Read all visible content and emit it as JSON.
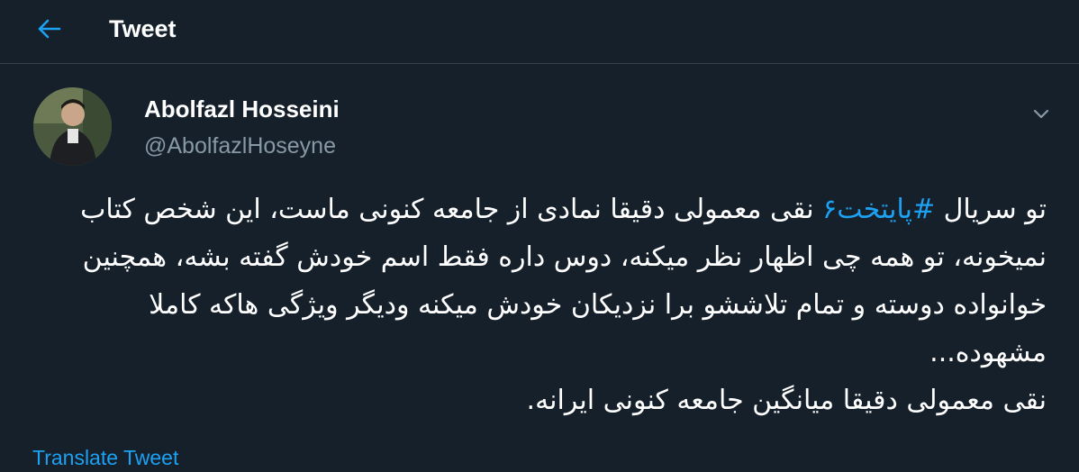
{
  "header": {
    "back_icon": "arrow-left-icon",
    "title": "Tweet"
  },
  "author": {
    "avatar_icon": "avatar",
    "name": "Abolfazl Hosseini",
    "handle": "@AbolfazlHoseyne",
    "menu_icon": "chevron-down-icon"
  },
  "tweet": {
    "text_before_hashtag": "تو سریال ",
    "hashtag": "#پایتخت۶",
    "text_after_hashtag": " نقی معمولی دقیقا نمادی از جامعه کنونی ماست، این شخص کتاب نمیخونه، تو همه چی اظهار نظر میکنه، دوس داره فقط اسم خودش گفته بشه، همچنین خوانواده دوسته و تمام تلاششو برا نزدیکان خودش میکنه ودیگر ویژگی هاکه کاملا مشهوده...\nنقی معمولی دقیقا میانگین جامعه کنونی ایرانه."
  },
  "actions": {
    "translate_label": "Translate Tweet"
  },
  "colors": {
    "background": "#15202b",
    "accent": "#1da1f2",
    "secondary_text": "#8899a6",
    "divider": "#38444d"
  }
}
